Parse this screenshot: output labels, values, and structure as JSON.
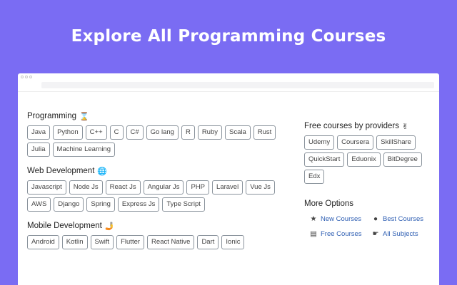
{
  "headline": "Explore All Programming Courses",
  "left_sections": [
    {
      "title": "Programming",
      "emoji": "⌛",
      "tags": [
        "Java",
        "Python",
        "C++",
        "C",
        "C#",
        "Go lang",
        "R",
        "Ruby",
        "Scala",
        "Rust",
        "Julia",
        "Machine Learning"
      ]
    },
    {
      "title": "Web Development",
      "emoji": "🌐",
      "tags": [
        "Javascript",
        "Node Js",
        "React Js",
        "Angular Js",
        "PHP",
        "Laravel",
        "Vue Js",
        "AWS",
        "Django",
        "Spring",
        "Express Js",
        "Type Script"
      ]
    },
    {
      "title": "Mobile Development",
      "emoji": "🤳",
      "tags": [
        "Android",
        "Kotlin",
        "Swift",
        "Flutter",
        "React Native",
        "Dart",
        "Ionic"
      ]
    }
  ],
  "providers": {
    "title": "Free courses by providers",
    "emoji": "✌",
    "tags": [
      "Udemy",
      "Coursera",
      "SkillShare",
      "QuickStart",
      "Eduonix",
      "BitDegree",
      "Edx"
    ]
  },
  "more_options": {
    "title": "More Options",
    "items": [
      {
        "label": "New Courses",
        "icon": "star-icon",
        "glyph": "★"
      },
      {
        "label": "Best Courses",
        "icon": "medal-icon",
        "glyph": "●"
      },
      {
        "label": "Free Courses",
        "icon": "books-icon",
        "glyph": "▤"
      },
      {
        "label": "All Subjects",
        "icon": "pointing-hand-icon",
        "glyph": "☛"
      }
    ]
  },
  "colors": {
    "background": "#7a6cf3",
    "link": "#2f5fb3",
    "tag_border": "#8a939c"
  }
}
